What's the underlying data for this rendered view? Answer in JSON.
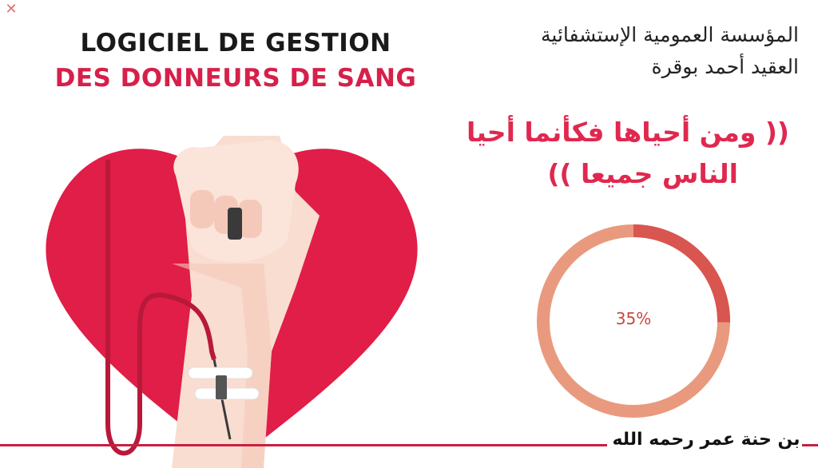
{
  "window": {
    "close_glyph": "✕",
    "close_icon": "close-icon"
  },
  "title": {
    "line1": "LOGICIEL DE GESTION",
    "line2": "DES DONNEURS DE SANG",
    "line2_color": "#d6204a"
  },
  "institution": {
    "line1": "المؤسسة العمومية الإستشفائية",
    "line2": "العقيد أحمد بوقرة"
  },
  "quote": {
    "open_mark": "((",
    "line1": "ومن أحياها فكأنما أحيا",
    "line2": "الناس جميعا",
    "close_mark": "))",
    "color": "#e0284f"
  },
  "illustration": {
    "icon": "heart-arm-blood-donation-icon"
  },
  "loading": {
    "progress": 0.35,
    "label": "35%",
    "track_color": "#e99a7e",
    "fill_color": "#d9554f"
  },
  "footer": {
    "dedication": "بن حنة عمر رحمه الله",
    "line_color": "#c8203f"
  }
}
